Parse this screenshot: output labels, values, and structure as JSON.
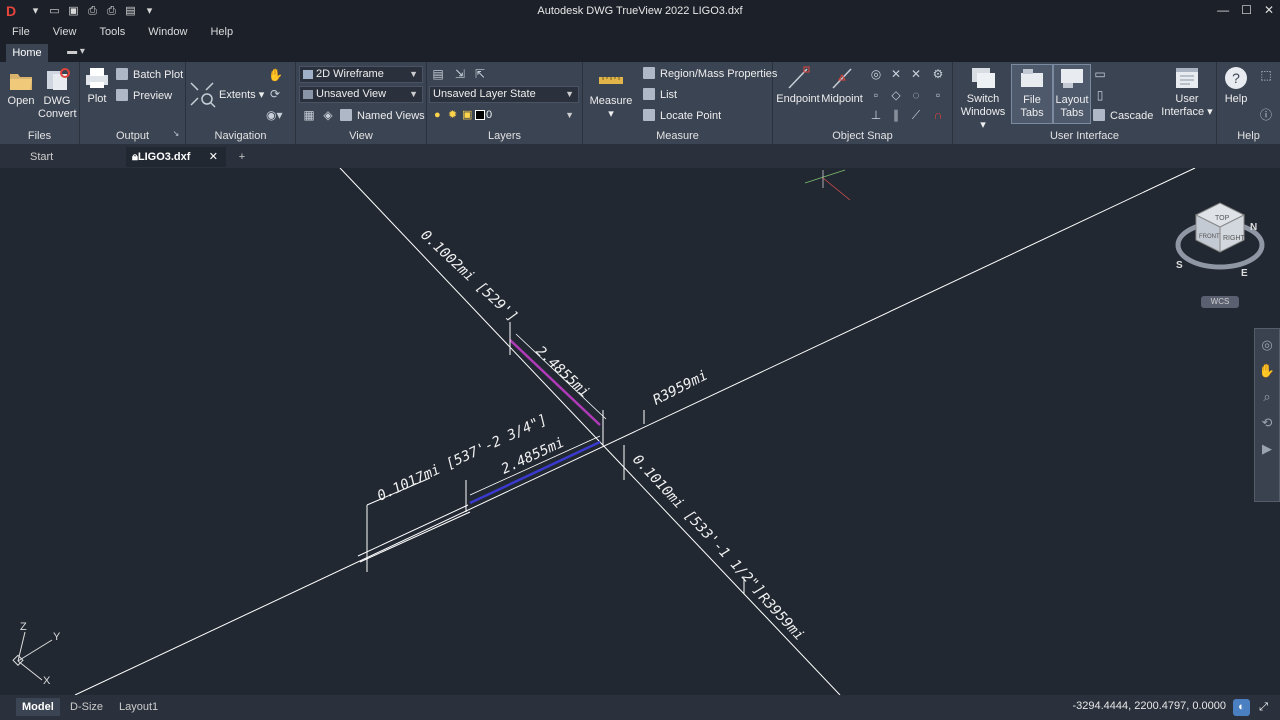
{
  "app": {
    "title": "Autodesk DWG TrueView 2022   LIGO3.dxf",
    "logo": "D"
  },
  "menu": [
    "File",
    "View",
    "Tools",
    "Window",
    "Help"
  ],
  "ribbon_tab": "Home",
  "panels": {
    "files": {
      "label": "Files",
      "open": "Open",
      "dwg_convert_1": "DWG",
      "dwg_convert_2": "Convert"
    },
    "output": {
      "label": "Output",
      "plot": "Plot",
      "batch_plot": "Batch Plot",
      "preview": "Preview"
    },
    "navigation": {
      "label": "Navigation",
      "extents": "Extents"
    },
    "view": {
      "label": "View",
      "visual_style": "2D Wireframe",
      "saved_view": "Unsaved View",
      "named_views": "Named Views"
    },
    "layers": {
      "label": "Layers",
      "layer_state": "Unsaved Layer State",
      "current_layer": "0"
    },
    "measure": {
      "label": "Measure",
      "measure": "Measure",
      "region": "Region/Mass Properties",
      "list": "List",
      "locate_point": "Locate Point"
    },
    "osnap": {
      "label": "Object Snap",
      "endpoint": "Endpoint",
      "midpoint": "Midpoint"
    },
    "ui": {
      "label": "User Interface",
      "switch_1": "Switch",
      "switch_2": "Windows",
      "file_tabs": "File Tabs",
      "layout_1": "Layout",
      "layout_2": "Tabs",
      "cascade": "Cascade",
      "user_1": "User",
      "user_2": "Interface"
    },
    "help": {
      "label": "Help",
      "help": "Help"
    }
  },
  "file_tabs": {
    "start": "Start",
    "doc": "LIGO3.dxf"
  },
  "drawing": {
    "dims": {
      "d1": "0.1002mi [529']",
      "d2": "2.4855mi",
      "d3": "R3959mi",
      "d4": "0.1017mi [537'-2 3/4\"]",
      "d5": "2.4855mi",
      "d6": "0.1010mi [533'-1 1/2\"]",
      "d7": "R3959mi"
    },
    "viewcube": {
      "top": "TOP",
      "front": "FRONT",
      "right": "RIGHT",
      "n": "N",
      "s": "S",
      "e": "E",
      "wcs": "WCS"
    },
    "ucs": {
      "x": "X",
      "y": "Y",
      "z": "Z"
    }
  },
  "status": {
    "tabs": [
      "Model",
      "D-Size",
      "Layout1"
    ],
    "coords": "-3294.4444, 2200.4797, 0.0000"
  },
  "colors": {
    "background": "#222832",
    "ribbon": "#3b4453",
    "line": "#ffffff",
    "highlight_magenta": "#b03ab8",
    "highlight_blue": "#3a3ad0"
  }
}
